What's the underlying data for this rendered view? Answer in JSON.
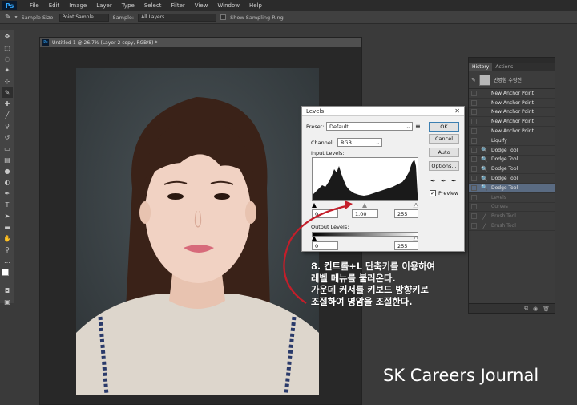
{
  "menubar": {
    "logo": "Ps",
    "items": [
      "File",
      "Edit",
      "Image",
      "Layer",
      "Type",
      "Select",
      "Filter",
      "View",
      "Window",
      "Help"
    ]
  },
  "options_bar": {
    "sample_size_label": "Sample Size:",
    "sample_size_value": "Point Sample",
    "sample_label": "Sample:",
    "sample_value": "All Layers",
    "show_ring_label": "Show Sampling Ring"
  },
  "document": {
    "title": "Untitled-1 @ 26.7% (Layer 2 copy, RGB/8) *"
  },
  "levels_dialog": {
    "title": "Levels",
    "preset_label": "Preset:",
    "preset_value": "Default",
    "channel_label": "Channel:",
    "channel_value": "RGB",
    "input_levels_label": "Input Levels:",
    "input_black": "0",
    "input_gamma": "1.00",
    "input_white": "255",
    "output_levels_label": "Output Levels:",
    "output_black": "0",
    "output_white": "255",
    "ok_label": "OK",
    "cancel_label": "Cancel",
    "auto_label": "Auto",
    "options_label": "Options...",
    "preview_label": "Preview",
    "preview_checked": true
  },
  "history_panel": {
    "tabs": [
      "History",
      "Actions"
    ],
    "snapshot_label": "반명함 수정전",
    "items": [
      {
        "icon": "",
        "label": "New Anchor Point",
        "state": "normal"
      },
      {
        "icon": "",
        "label": "New Anchor Point",
        "state": "normal"
      },
      {
        "icon": "",
        "label": "New Anchor Point",
        "state": "normal"
      },
      {
        "icon": "",
        "label": "New Anchor Point",
        "state": "normal"
      },
      {
        "icon": "",
        "label": "New Anchor Point",
        "state": "normal"
      },
      {
        "icon": "",
        "label": "Liquify",
        "state": "normal"
      },
      {
        "icon": "🔍",
        "label": "Dodge Tool",
        "state": "normal"
      },
      {
        "icon": "🔍",
        "label": "Dodge Tool",
        "state": "normal"
      },
      {
        "icon": "🔍",
        "label": "Dodge Tool",
        "state": "normal"
      },
      {
        "icon": "🔍",
        "label": "Dodge Tool",
        "state": "normal"
      },
      {
        "icon": "🔍",
        "label": "Dodge Tool",
        "state": "selected"
      },
      {
        "icon": "",
        "label": "Levels",
        "state": "dim"
      },
      {
        "icon": "",
        "label": "Curves",
        "state": "dim"
      },
      {
        "icon": "╱",
        "label": "Brush Tool",
        "state": "dim"
      },
      {
        "icon": "╱",
        "label": "Brush Tool",
        "state": "dim"
      }
    ]
  },
  "annotation": {
    "lines": [
      "8. 컨트롤+L 단축키를 이용하여",
      "레벨 메뉴를 불러온다.",
      "가운데 커서를 키보드 방향키로",
      "조절하여 명암을 조절한다."
    ],
    "arrow_color": "#c41e2a"
  },
  "watermark": "SK Careers Journal",
  "colors": {
    "ps_accent": "#31a8ff",
    "selection": "#5a6b82",
    "panel_bg": "#3c3c3c"
  }
}
